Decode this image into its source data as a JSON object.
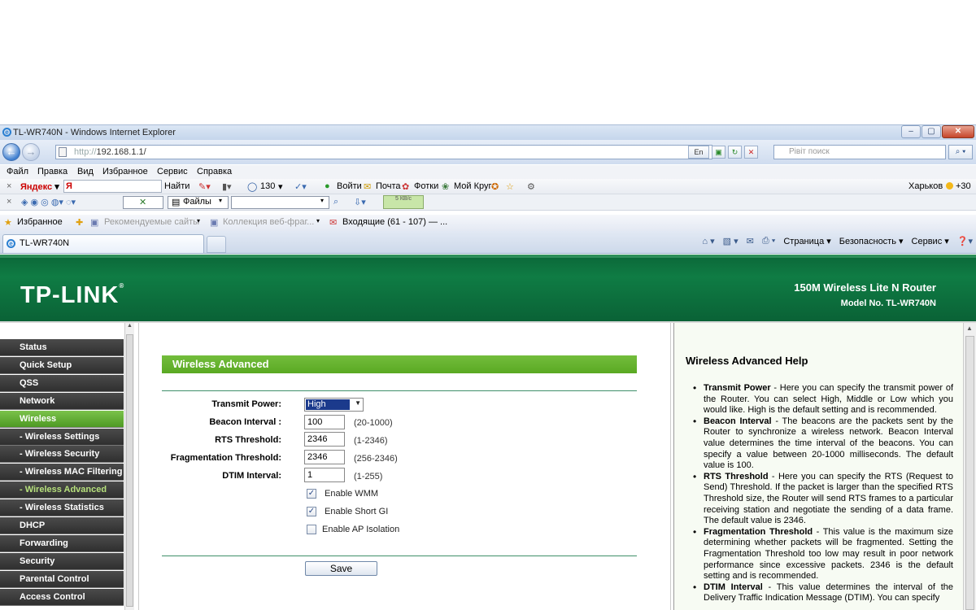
{
  "browser": {
    "window_title": "TL-WR740N - Windows Internet Explorer",
    "address_proto": "http://",
    "address_host": "192.168.1.1/",
    "language_indicator": "En",
    "search_placeholder": "Рівіт поиск",
    "window_buttons": {
      "minimize": "–",
      "maximize": "▢",
      "close": "✕"
    },
    "menu": [
      "Файл",
      "Правка",
      "Вид",
      "Избранное",
      "Сервис",
      "Справка"
    ],
    "yandex_toolbar": {
      "brand": "Яндекс",
      "find": "Найти",
      "mail_count": "130",
      "login": "Войти",
      "mail": "Почта",
      "photos": "Фотки",
      "my_circle": "Мой Круг",
      "city": "Харьков",
      "temperature": "+30"
    },
    "toolbar3": {
      "files": "Файлы",
      "speed": "5 КВ/с"
    },
    "favorites_bar": {
      "favorites": "Избранное",
      "recommended": "Рекомендуемые сайты",
      "gallery": "Коллекция веб-фраг...",
      "inbox": "Входящие (61 - 107) — ..."
    },
    "tab_title": "TL-WR740N",
    "command_bar": {
      "page": "Страница",
      "safety": "Безопасность",
      "tools": "Сервис"
    }
  },
  "router": {
    "logo": "TP-LINK",
    "product_name": "150M Wireless Lite N Router",
    "model_no": "Model No. TL-WR740N",
    "nav": [
      {
        "label": "Status",
        "type": "main"
      },
      {
        "label": "Quick Setup",
        "type": "main"
      },
      {
        "label": "QSS",
        "type": "main"
      },
      {
        "label": "Network",
        "type": "main"
      },
      {
        "label": "Wireless",
        "type": "active"
      },
      {
        "label": "- Wireless Settings",
        "type": "sub"
      },
      {
        "label": "- Wireless Security",
        "type": "sub"
      },
      {
        "label": "- Wireless MAC Filtering",
        "type": "sub"
      },
      {
        "label": "- Wireless Advanced",
        "type": "current"
      },
      {
        "label": "- Wireless Statistics",
        "type": "sub"
      },
      {
        "label": "DHCP",
        "type": "main"
      },
      {
        "label": "Forwarding",
        "type": "main"
      },
      {
        "label": "Security",
        "type": "main"
      },
      {
        "label": "Parental Control",
        "type": "main"
      },
      {
        "label": "Access Control",
        "type": "main"
      }
    ],
    "form": {
      "title": "Wireless Advanced",
      "transmit_power_label": "Transmit Power:",
      "transmit_power_value": "High",
      "beacon_label": "Beacon Interval :",
      "beacon_value": "100",
      "beacon_range": "(20-1000)",
      "rts_label": "RTS Threshold:",
      "rts_value": "2346",
      "rts_range": "(1-2346)",
      "frag_label": "Fragmentation Threshold:",
      "frag_value": "2346",
      "frag_range": "(256-2346)",
      "dtim_label": "DTIM Interval:",
      "dtim_value": "1",
      "dtim_range": "(1-255)",
      "wmm_label": "Enable WMM",
      "wmm_checked": true,
      "shortgi_label": "Enable Short GI",
      "shortgi_checked": true,
      "isolation_label": "Enable AP Isolation",
      "isolation_checked": false,
      "save_label": "Save"
    },
    "help": {
      "title": "Wireless Advanced Help",
      "items": [
        {
          "term": "Transmit Power",
          "text": " - Here you can specify the transmit power of the Router. You can select High, Middle or Low which you would like. High is the default setting and is recommended."
        },
        {
          "term": "Beacon Interval",
          "text": " - The beacons are the packets sent by the Router to synchronize a wireless network. Beacon Interval value determines the time interval of the beacons. You can specify a value between 20-1000 milliseconds. The default value is 100."
        },
        {
          "term": "RTS Threshold",
          "text": " - Here you can specify the RTS (Request to Send) Threshold. If the packet is larger than the specified RTS Threshold size, the Router will send RTS frames to a particular receiving station and negotiate the sending of a data frame. The default value is 2346."
        },
        {
          "term": "Fragmentation Threshold",
          "text": " - This value is the maximum size determining whether packets will be fragmented. Setting the Fragmentation Threshold too low may result in poor network performance since excessive packets. 2346 is the default setting and is recommended."
        },
        {
          "term": "DTIM Interval",
          "text": " - This value determines the interval of the Delivery Traffic Indication Message (DTIM). You can specify"
        }
      ]
    }
  }
}
